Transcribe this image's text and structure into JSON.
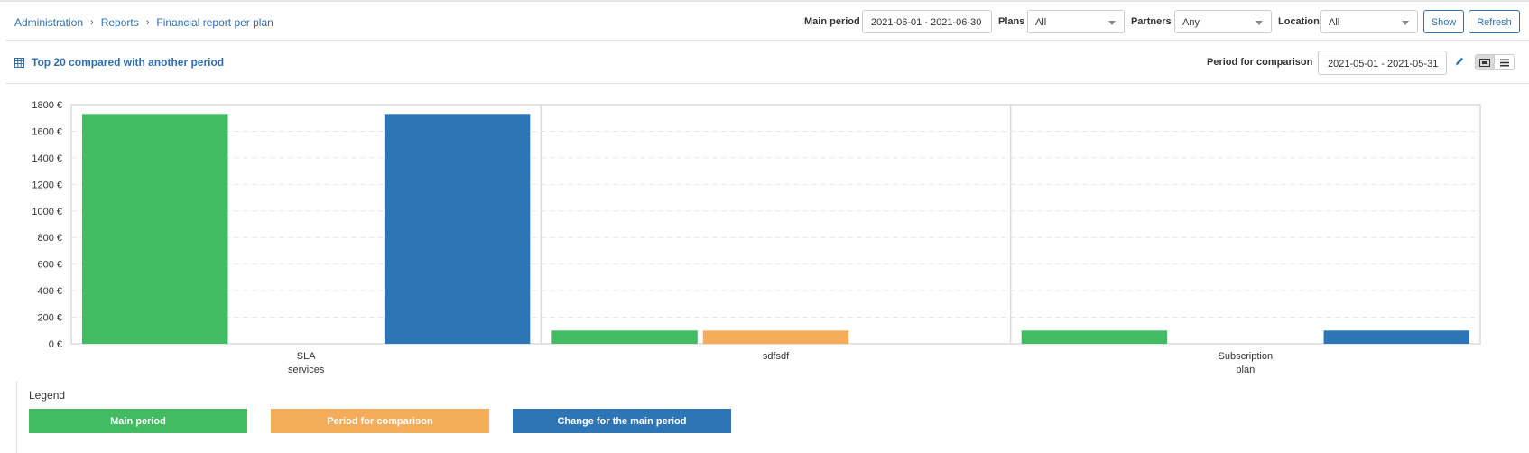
{
  "breadcrumb": [
    "Administration",
    "Reports",
    "Financial report per plan"
  ],
  "filters": {
    "main_period_label": "Main period",
    "main_period_value": "2021-06-01 - 2021-06-30",
    "plans_label": "Plans",
    "plans_value": "All",
    "partners_label": "Partners",
    "partners_value": "Any",
    "location_label": "Location",
    "location_value": "All",
    "show_button": "Show",
    "refresh_button": "Refresh"
  },
  "panel": {
    "title": "Top 20 compared with another period",
    "title_icon": "table-icon",
    "comparison_label": "Period for comparison",
    "comparison_value": "2021-05-01 - 2021-05-31",
    "edit_icon": "pencil-icon",
    "view_icons": [
      "chart-view-icon",
      "list-view-icon"
    ]
  },
  "colors": {
    "main_period": "#43bb63",
    "comparison": "#f5ad5b",
    "change": "#2e75b5",
    "link": "#2f6fb1"
  },
  "chart_data": {
    "type": "bar",
    "categories": [
      [
        "SLA",
        "services"
      ],
      [
        "sdfsdf"
      ],
      [
        "Subscription",
        "plan"
      ]
    ],
    "series": [
      {
        "name": "Main period",
        "values": [
          1730,
          100,
          100
        ]
      },
      {
        "name": "Period for comparison",
        "values": [
          0,
          100,
          0
        ]
      },
      {
        "name": "Change for the main period",
        "values": [
          1730,
          0,
          100
        ]
      }
    ],
    "yticks": [
      "0 €",
      "200 €",
      "400 €",
      "600 €",
      "800 €",
      "1000 €",
      "1200 €",
      "1400 €",
      "1600 €",
      "1800 €"
    ],
    "ylim": [
      0,
      1800
    ],
    "grid": true
  },
  "legend": {
    "title": "Legend",
    "items": [
      "Main period",
      "Period for comparison",
      "Change for the main period"
    ]
  }
}
